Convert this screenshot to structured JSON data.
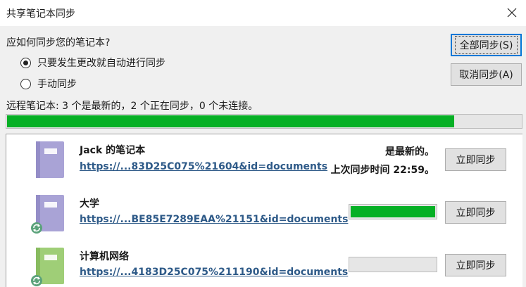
{
  "window": {
    "title": "共享笔记本同步"
  },
  "dialog": {
    "question": "应如何同步您的笔记本?",
    "options": [
      {
        "label": "只要发生更改就自动进行同步",
        "selected": true
      },
      {
        "label": "手动同步",
        "selected": false
      }
    ],
    "status": "远程笔记本: 3 个是最新的，2 个正在同步，0 个未连接。",
    "overall_progress": 0.87,
    "buttons": {
      "sync_all": "全部同步(S)",
      "cancel_sync": "取消同步(A)"
    }
  },
  "notebooks": [
    {
      "name": "Jack 的笔记本",
      "url": "https://...83D25C075%21604&id=documents",
      "status_line1": "是最新的。",
      "status_line2": "上次同步时间 22:59。",
      "color": "#a9a3d6",
      "syncing": false,
      "progress": null,
      "sync_button": "立即同步"
    },
    {
      "name": "大学",
      "url": "https://...BE85E7289EAA%21151&id=documents",
      "color": "#a9a3d6",
      "syncing": true,
      "progress": 1.0,
      "sync_button": "立即同步"
    },
    {
      "name": "计算机网络",
      "url": "https://...4183D25C075%211190&id=documents",
      "color": "#9fce77",
      "syncing": true,
      "progress": 0.0,
      "sync_button": "立即同步"
    }
  ],
  "colors": {
    "progress_green": "#06b025",
    "link_blue": "#2e5a88",
    "accent_blue": "#0078d7"
  }
}
